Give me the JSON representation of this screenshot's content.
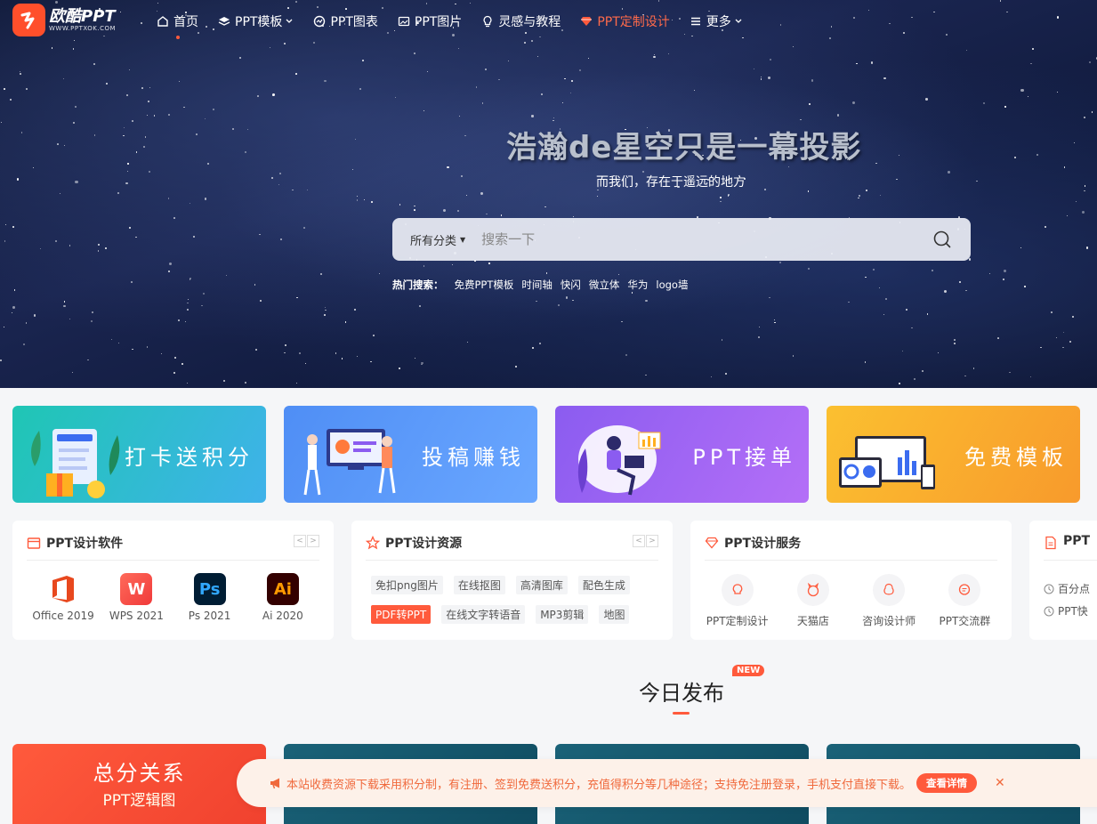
{
  "nav": {
    "logo_name": "欧酷PPT",
    "logo_url": "WWW.PPTXOK.COM",
    "items": [
      {
        "label": "首页",
        "icon": "home-icon"
      },
      {
        "label": "PPT模板",
        "icon": "layers-icon",
        "dropdown": true
      },
      {
        "label": "PPT图表",
        "icon": "chart-icon"
      },
      {
        "label": "PPT图片",
        "icon": "image-icon"
      },
      {
        "label": "灵感与教程",
        "icon": "bulb-icon"
      },
      {
        "label": "PPT定制设计",
        "icon": "diamond-icon"
      },
      {
        "label": "更多",
        "icon": "menu-icon",
        "dropdown": true
      }
    ]
  },
  "hero": {
    "title": "浩瀚de星空只是一幕投影",
    "subtitle": "而我们，存在于遥远的地方",
    "search_category": "所有分类",
    "search_placeholder": "搜索一下",
    "hot_label": "热门搜索：",
    "hot_keywords": [
      "免费PPT模板",
      "时间轴",
      "快闪",
      "微立体",
      "华为",
      "logo墙"
    ]
  },
  "banners": [
    {
      "label": "打卡送积分"
    },
    {
      "label": "投稿赚钱"
    },
    {
      "label": "PPT接单"
    },
    {
      "label": "免费模板"
    }
  ],
  "cards": {
    "software": {
      "title": "PPT设计软件",
      "items": [
        {
          "label": "Office 2019",
          "glyph": ""
        },
        {
          "label": "WPS 2021",
          "glyph": "W"
        },
        {
          "label": "Ps 2021",
          "glyph": "Ps"
        },
        {
          "label": "Ai 2020",
          "glyph": "Ai"
        }
      ]
    },
    "resources": {
      "title": "PPT设计资源",
      "row1": [
        "免扣png图片",
        "在线抠图",
        "高清图库",
        "配色生成"
      ],
      "row2": [
        "PDF转PPT",
        "在线文字转语音",
        "MP3剪辑",
        "地图"
      ]
    },
    "services": {
      "title": "PPT设计服务",
      "items": [
        "PPT定制设计",
        "天猫店",
        "咨询设计师",
        "PPT交流群"
      ]
    },
    "news": {
      "title": "PPT",
      "items": [
        "百分点",
        "PPT快"
      ]
    }
  },
  "section": {
    "title": "今日发布",
    "badge": "NEW"
  },
  "thumbs": [
    {
      "title": "总分关系",
      "subtitle": "PPT逻辑图"
    },
    {
      "title": "",
      "subtitle": ""
    },
    {
      "title": "",
      "subtitle": ""
    },
    {
      "title": "",
      "subtitle": ""
    }
  ],
  "notice": {
    "text": "本站收费资源下载采用积分制，有注册、签到免费送积分，充值得积分等几种途径；支持免注册登录，手机支付直接下载。",
    "button": "查看详情"
  },
  "colors": {
    "accent": "#ff5a3c",
    "notice_bg": "#fdf1e9"
  }
}
